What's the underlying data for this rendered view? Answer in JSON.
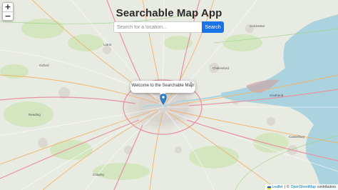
{
  "app": {
    "title": "Searchable Map App"
  },
  "search": {
    "placeholder": "Search for a location...",
    "button_label": "Search"
  },
  "zoom": {
    "in_label": "+",
    "out_label": "−"
  },
  "popup": {
    "text": "Welcome to the Searchable Map!",
    "close_label": "×"
  },
  "attribution": {
    "leaflet": "Leaflet",
    "separator": "|",
    "prefix": "©",
    "osm": "OpenStreetMap",
    "suffix": "contributors"
  },
  "colors": {
    "accent": "#1a73e8",
    "water": "#aad3df",
    "land": "#e8ebe2",
    "motorway": "#e892a2",
    "primary": "#fcd6a4",
    "urban": "#dedad6"
  }
}
